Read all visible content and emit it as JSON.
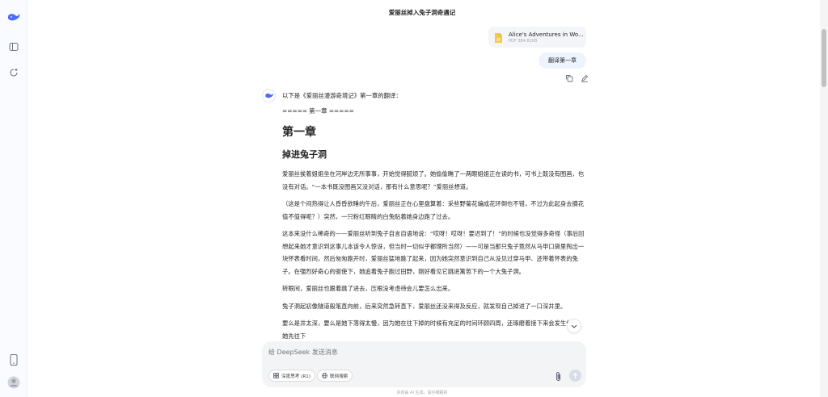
{
  "sidebar": {
    "logo_icon": "whale-logo-icon",
    "toggle_icon": "sidebar-toggle-icon",
    "new_chat_icon": "new-chat-icon",
    "mobile_icon": "phone-icon",
    "avatar_icon": "user-avatar-icon"
  },
  "header": {
    "title": "爱丽丝掉入兔子洞奇遇记"
  },
  "file": {
    "name": "Alice's Adventures in Wo...",
    "meta": "PDF 384.62KB",
    "icon": "file-icon",
    "icon_color": "#f2c94c"
  },
  "user_message": {
    "text": "翻译第一章"
  },
  "assistant": {
    "intro": "以下是《爱丽丝漫游奇境记》第一章的翻译：",
    "divider": "===== 第一章 =====",
    "heading1": "第一章",
    "heading2": "掉进兔子洞",
    "paragraphs": [
      "爱丽丝挨着姐姐坐在河岸边无所事事，开始觉得腻烦了。她偷偷瞧了一两眼姐姐正在读的书，可书上既没有图画，也没有对话。“一本书既没图画又没对话，那有什么意思呢？”爱丽丝想道。",
      "（这是个闷热得让人昏昏欲睡的午后，爱丽丝正在心里盘算着：采些野菊花编成花环倒也不错，不过为此起身去摘花值不值得呢？）突然，一只粉红眼睛的白兔贴着她身边跑了过去。",
      "这本来没什么稀奇的——爱丽丝听到兔子自言自语地说：“哎呀！哎呀！要迟到了！”的时候也没觉得多奇怪（事后回想起来她才意识到这事儿本该令人惊讶，但当时一切似乎都理所当然）——可是当那只兔子竟然从马甲口袋里掏出一块怀表看时间，然后匆匆跑开时，爱丽丝猛地跳了起来，因为她突然意识到自己从没见过穿马甲、还带着怀表的兔子。在强烈好奇心的驱使下，她追着兔子跑过田野，刚好看见它跳进篱笆下的一个大兔子洞。",
      "转眼间，爱丽丝也跟着跳了进去，压根没考虑待会儿要怎么出来。",
      "兔子洞起初像隧道般笔直向前，后来突然急转直下，爱丽丝还没来得及反应，就发现自己掉进了一口深井里。",
      "要么是井太深，要么是她下落得太慢，因为她在往下掉的时候有充足的时间环顾四周，还琢磨着接下来会发生什么。她先往下"
    ]
  },
  "input": {
    "placeholder": "给 DeepSeek 发送消息",
    "deep_think_label": "深度思考 (R1)",
    "web_search_label": "联网搜索"
  },
  "footer": {
    "note": "内容由 AI 生成，请仔细甄别"
  },
  "colors": {
    "accent": "#4d6bfe",
    "bubble": "#eef4fe"
  }
}
